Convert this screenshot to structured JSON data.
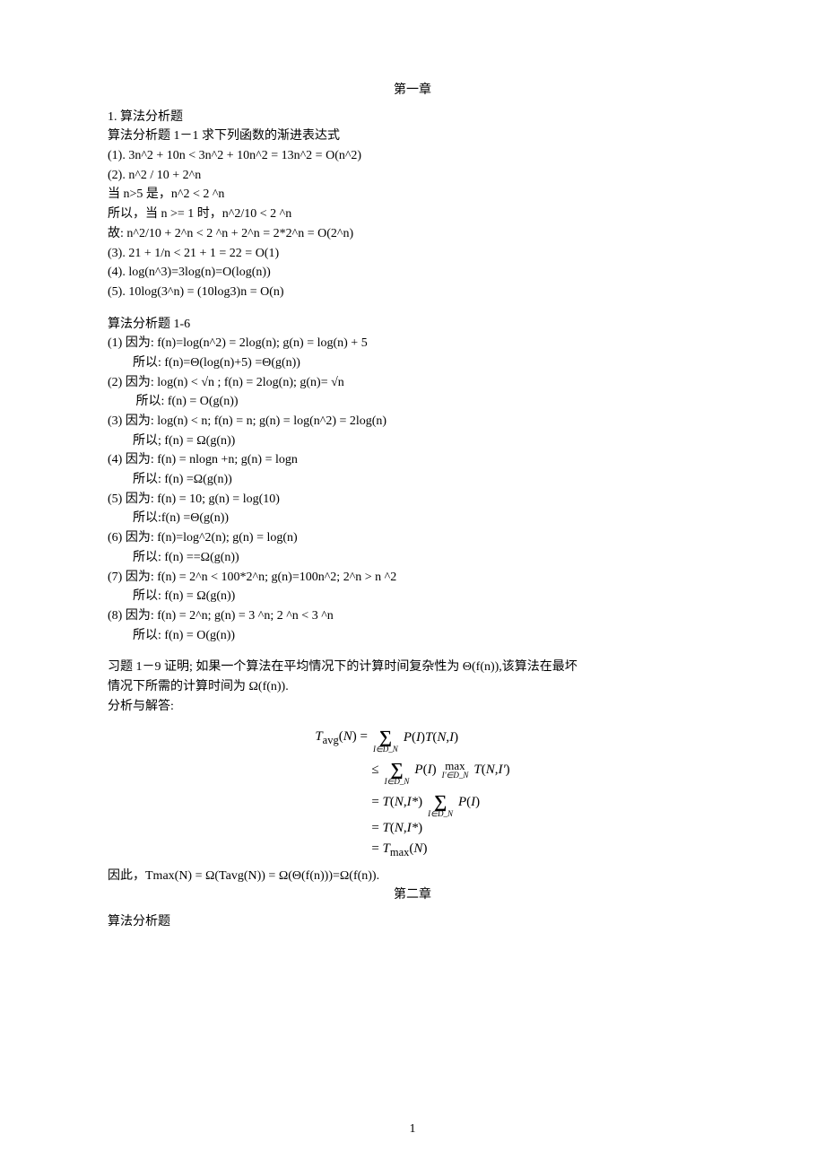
{
  "chapter1_title": "第一章",
  "intro": [
    "1. 算法分析题",
    "算法分析题 1－1 求下列函数的渐进表达式",
    "(1). 3n^2 + 10n < 3n^2 + 10n^2 = 13n^2 = O(n^2)",
    "(2). n^2 / 10 + 2^n",
    "当 n>5 是，n^2 < 2 ^n",
    "所以，当 n >= 1 时，n^2/10 < 2 ^n",
    "故: n^2/10 + 2^n < 2 ^n + 2^n = 2*2^n = O(2^n)",
    "(3). 21 + 1/n < 21 + 1 = 22 = O(1)",
    "(4). log(n^3)=3log(n)=O(log(n))",
    "(5). 10log(3^n) = (10log3)n = O(n)"
  ],
  "sec16_title": "算法分析题 1-6",
  "sec16": [
    {
      "a": "(1) 因为: f(n)=log(n^2) = 2log(n); g(n) = log(n) + 5",
      "b": "所以: f(n)=Θ(log(n)+5) =Θ(g(n))"
    },
    {
      "a": "(2) 因为: log(n) < √n ; f(n) = 2log(n); g(n)= √n",
      "b": " 所以: f(n) = O(g(n))"
    },
    {
      "a": "(3) 因为: log(n) < n; f(n) = n; g(n) = log(n^2) = 2log(n)",
      "b": "所以; f(n) = Ω(g(n))"
    },
    {
      "a": "(4) 因为: f(n) = nlogn +n; g(n) = logn",
      "b": "所以: f(n) =Ω(g(n))"
    },
    {
      "a": "(5) 因为: f(n) = 10; g(n) = log(10)",
      "b": "所以:f(n) =Θ(g(n))"
    },
    {
      "a": "(6) 因为: f(n)=log^2(n); g(n) = log(n)",
      "b": "所以: f(n) ==Ω(g(n))"
    },
    {
      "a": "(7) 因为: f(n) = 2^n < 100*2^n; g(n)=100n^2; 2^n > n ^2",
      "b": "所以: f(n) = Ω(g(n))"
    },
    {
      "a": "(8) 因为: f(n) = 2^n; g(n) = 3 ^n; 2 ^n < 3 ^n",
      "b": "所以: f(n) = O(g(n))"
    }
  ],
  "problem19": [
    "习题 1－9 证明; 如果一个算法在平均情况下的计算时间复杂性为 Θ(f(n)),该算法在最坏",
    "情况下所需的计算时间为 Ω(f(n)).",
    "分析与解答:"
  ],
  "math": {
    "line1_left": "T_avg(N) =",
    "line1_sum_bottom": "I∈D_N",
    "line1_right": "P(I)T(N,I)",
    "line2_lead": "≤",
    "line2_sum_bottom": "I∈D_N",
    "line2_mid": "P(I)",
    "line2_max_bottom": "I'∈D_N",
    "line2_right": "T(N,I')",
    "line3": "= T(N,I*) ",
    "line3_sum_bottom": "I∈D_N",
    "line3_right": "P(I)",
    "line4": "= T(N,I*)",
    "line5": "= T_max(N)"
  },
  "conclusion": "因此，Tmax(N) = Ω(Tavg(N)) = Ω(Θ(f(n)))=Ω(f(n)).",
  "chapter2_title": "第二章",
  "chapter2_sub": "算法分析题",
  "page_number": "1"
}
